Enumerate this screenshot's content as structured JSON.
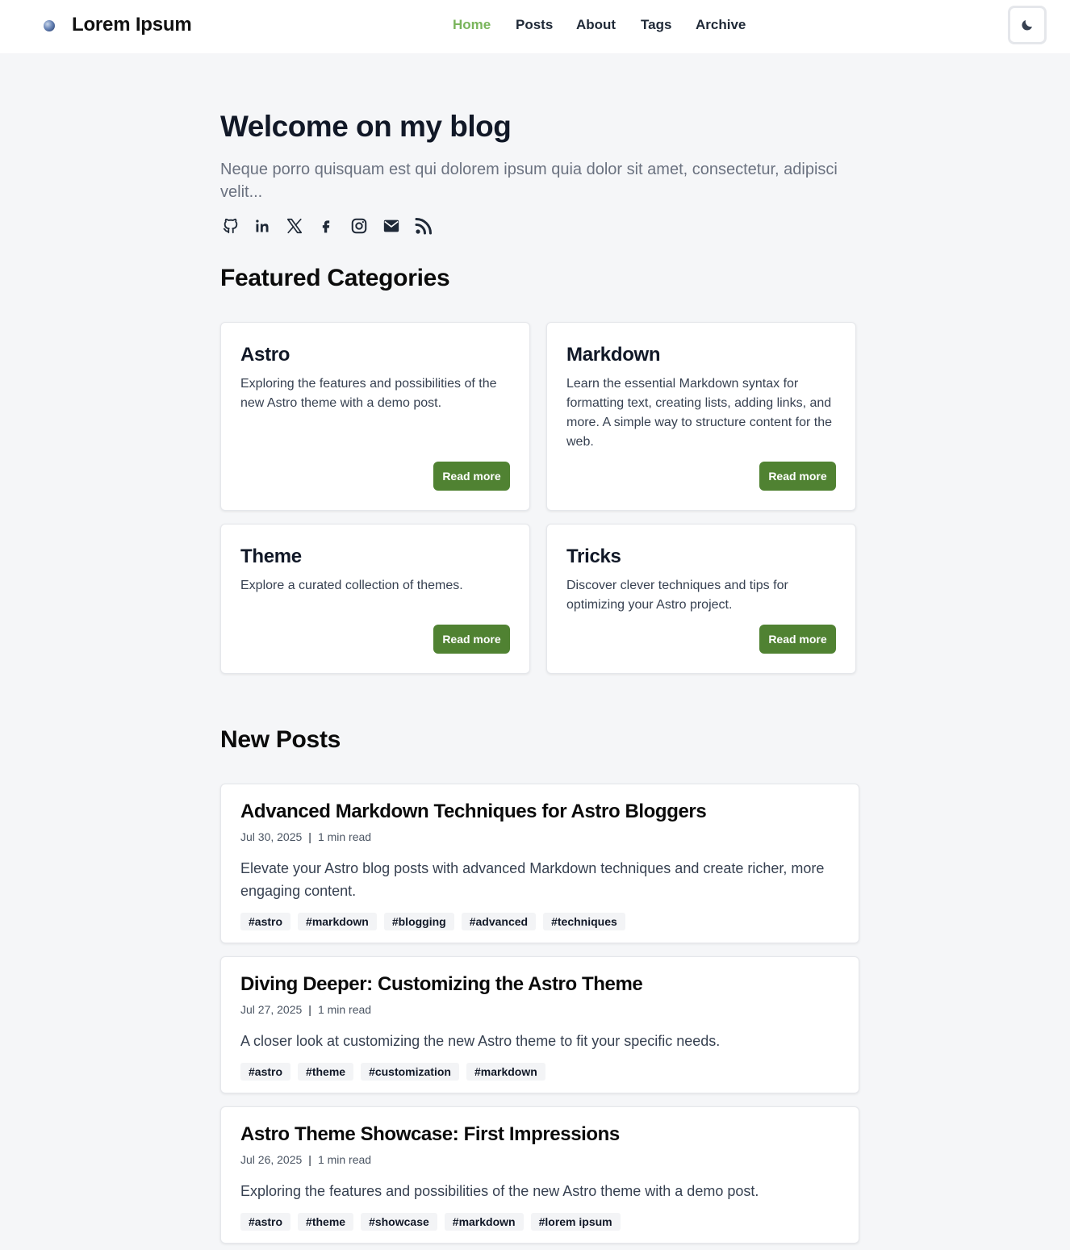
{
  "header": {
    "site_title": "Lorem Ipsum",
    "nav": [
      {
        "label": "Home",
        "active": true
      },
      {
        "label": "Posts",
        "active": false
      },
      {
        "label": "About",
        "active": false
      },
      {
        "label": "Tags",
        "active": false
      },
      {
        "label": "Archive",
        "active": false
      }
    ],
    "theme_toggle_icon": "moon-icon"
  },
  "hero": {
    "title": "Welcome on my blog",
    "subtitle": "Neque porro quisquam est qui dolorem ipsum quia dolor sit amet, consectetur, adipisci velit...",
    "socials": [
      "github-icon",
      "linkedin-icon",
      "x-icon",
      "facebook-icon",
      "instagram-icon",
      "mail-icon",
      "rss-icon"
    ]
  },
  "featured": {
    "title": "Featured Categories",
    "cards": [
      {
        "title": "Astro",
        "description": "Exploring the features and possibilities of the new Astro theme with a demo post.",
        "button": "Read more"
      },
      {
        "title": "Markdown",
        "description": "Learn the essential Markdown syntax for formatting text, creating lists, adding links, and more. A simple way to structure content for the web.",
        "button": "Read more"
      },
      {
        "title": "Theme",
        "description": "Explore a curated collection of themes.",
        "button": "Read more"
      },
      {
        "title": "Tricks",
        "description": "Discover clever techniques and tips for optimizing your Astro project.",
        "button": "Read more"
      }
    ]
  },
  "new_posts": {
    "title": "New Posts",
    "posts": [
      {
        "title": "Advanced Markdown Techniques for Astro Bloggers",
        "date": "Jul 30, 2025",
        "separator": "|",
        "read_time": "1 min read",
        "excerpt": "Elevate your Astro blog posts with advanced Markdown techniques and create richer, more engaging content.",
        "tags": [
          "#astro",
          "#markdown",
          "#blogging",
          "#advanced",
          "#techniques"
        ]
      },
      {
        "title": "Diving Deeper: Customizing the Astro Theme",
        "date": "Jul 27, 2025",
        "separator": "|",
        "read_time": "1 min read",
        "excerpt": "A closer look at customizing the new Astro theme to fit your specific needs.",
        "tags": [
          "#astro",
          "#theme",
          "#customization",
          "#markdown"
        ]
      },
      {
        "title": "Astro Theme Showcase: First Impressions",
        "date": "Jul 26, 2025",
        "separator": "|",
        "read_time": "1 min read",
        "excerpt": "Exploring the features and possibilities of the new Astro theme with a demo post.",
        "tags": [
          "#astro",
          "#theme",
          "#showcase",
          "#markdown",
          "#lorem ipsum"
        ]
      }
    ]
  },
  "colors": {
    "accent": "#508232",
    "nav_active": "#7ab55c",
    "background": "#f5f6f8"
  }
}
